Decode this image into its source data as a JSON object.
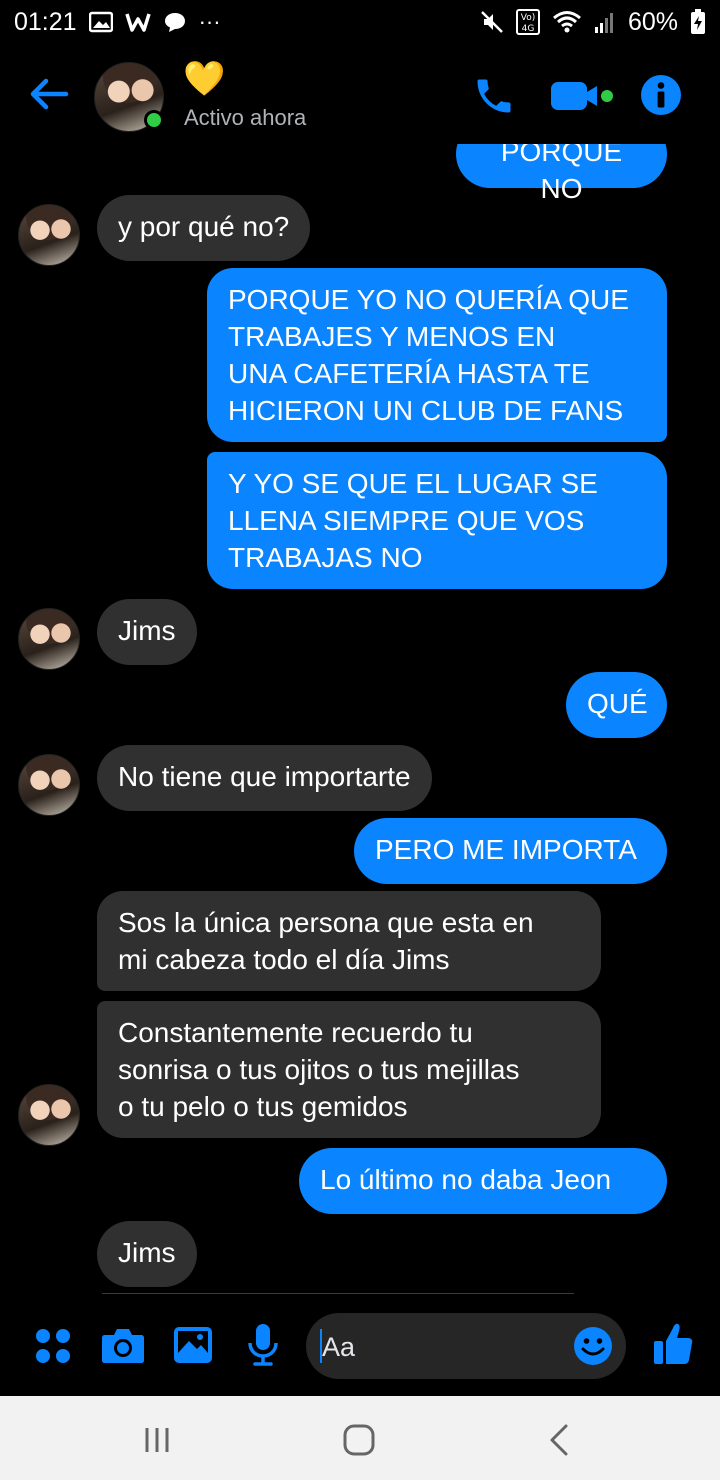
{
  "status_bar": {
    "time": "01:21",
    "left_glyphs": [
      "image-icon",
      "w-icon",
      "chat-icon",
      "more-icon"
    ],
    "more": "···",
    "battery": "60%"
  },
  "header": {
    "heart": "💛",
    "status": "Activo ahora",
    "accent_color": "#0a84ff",
    "online_color": "#31cc46"
  },
  "messages": [
    {
      "from": "me",
      "text": "PORQUE NO"
    },
    {
      "from": "them",
      "text": "y por qué no?"
    },
    {
      "from": "me",
      "text": "PORQUE YO NO QUERÍA QUE\nTRABAJES Y MENOS EN\nUNA CAFETERÍA HASTA TE\nHICIERON UN CLUB DE FANS"
    },
    {
      "from": "me",
      "text": "Y YO SE QUE EL LUGAR SE\nLLENA SIEMPRE QUE VOS\nTRABAJAS NO"
    },
    {
      "from": "them",
      "text": "Jims"
    },
    {
      "from": "me",
      "text": "QUÉ"
    },
    {
      "from": "them",
      "text": "No tiene que importarte"
    },
    {
      "from": "me",
      "text": "PERO ME IMPORTA"
    },
    {
      "from": "them",
      "text": "Sos la única persona que esta en\nmi cabeza todo el día Jims"
    },
    {
      "from": "them",
      "text": "Constantemente recuerdo tu\nsonrisa o tus ojitos o tus mejillas\no tu pelo o tus gemidos"
    },
    {
      "from": "me",
      "text": "Lo último no daba Jeon"
    },
    {
      "from": "them",
      "text": "Jims"
    }
  ],
  "composer": {
    "placeholder": "Aa",
    "icons": [
      "apps-icon",
      "camera-icon",
      "gallery-icon",
      "microphone-icon",
      "emoji-icon",
      "thumbs-up-icon"
    ]
  },
  "nav": {
    "buttons": [
      "recent-apps-button",
      "home-button",
      "back-nav-button"
    ]
  }
}
